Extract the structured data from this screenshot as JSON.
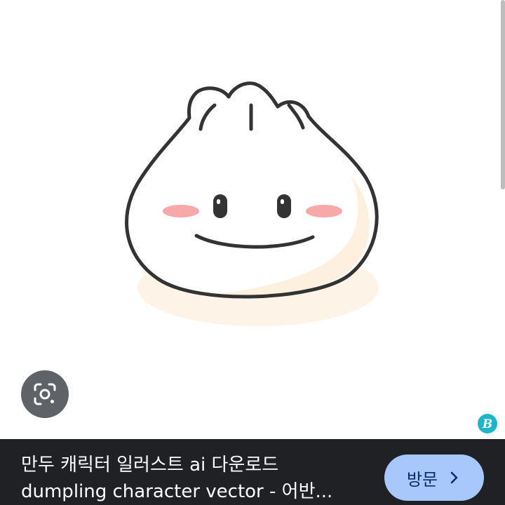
{
  "result": {
    "title_line_1": "만두 캐릭터 일러스트 ai 다운로드",
    "title_line_2": "dumpling character vector - 어반...",
    "visit_label": "방문"
  },
  "icons": {
    "lens": "google-lens-icon",
    "site_badge": "site-favicon-icon",
    "visit_chevron": "chevron-right-icon"
  },
  "colors": {
    "bottom_bar": "#202124",
    "visit_button": "#a8c7fa",
    "lens_button": "#5f6368",
    "blush": "#f7a8a8",
    "badge": "#1fb5c9"
  }
}
